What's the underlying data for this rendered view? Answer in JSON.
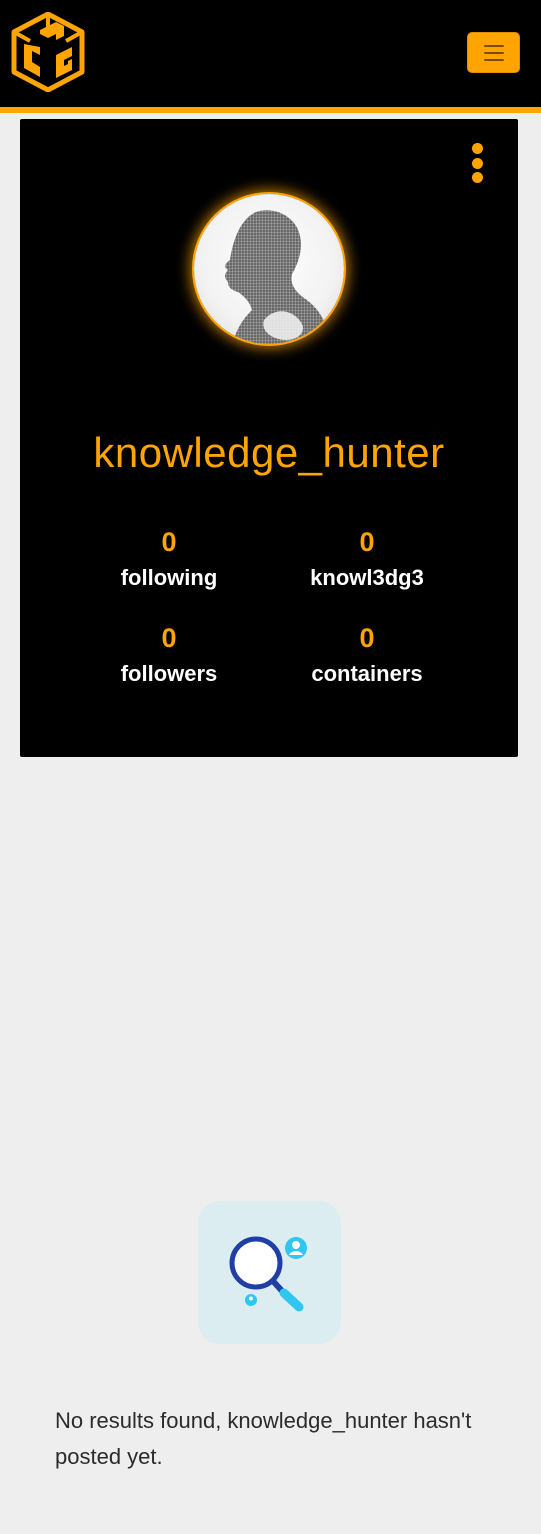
{
  "header": {
    "logo_icon": "cube-logo-icon",
    "menu_icon": "hamburger-menu-icon",
    "accent_color": "#ffa400",
    "background_color": "#000000"
  },
  "profile": {
    "options_icon": "vertical-dots-icon",
    "avatar_icon": "profile-head-silhouette",
    "username": "knowledge_hunter",
    "stats": {
      "following": {
        "value": "0",
        "label": "following"
      },
      "knowledge": {
        "value": "0",
        "label": "knowl3dg3"
      },
      "followers": {
        "value": "0",
        "label": "followers"
      },
      "containers": {
        "value": "0",
        "label": "containers"
      }
    }
  },
  "empty_state": {
    "illustration_icon": "magnifier-search-users-icon",
    "message": "No results found, knowledge_hunter hasn't posted yet."
  }
}
